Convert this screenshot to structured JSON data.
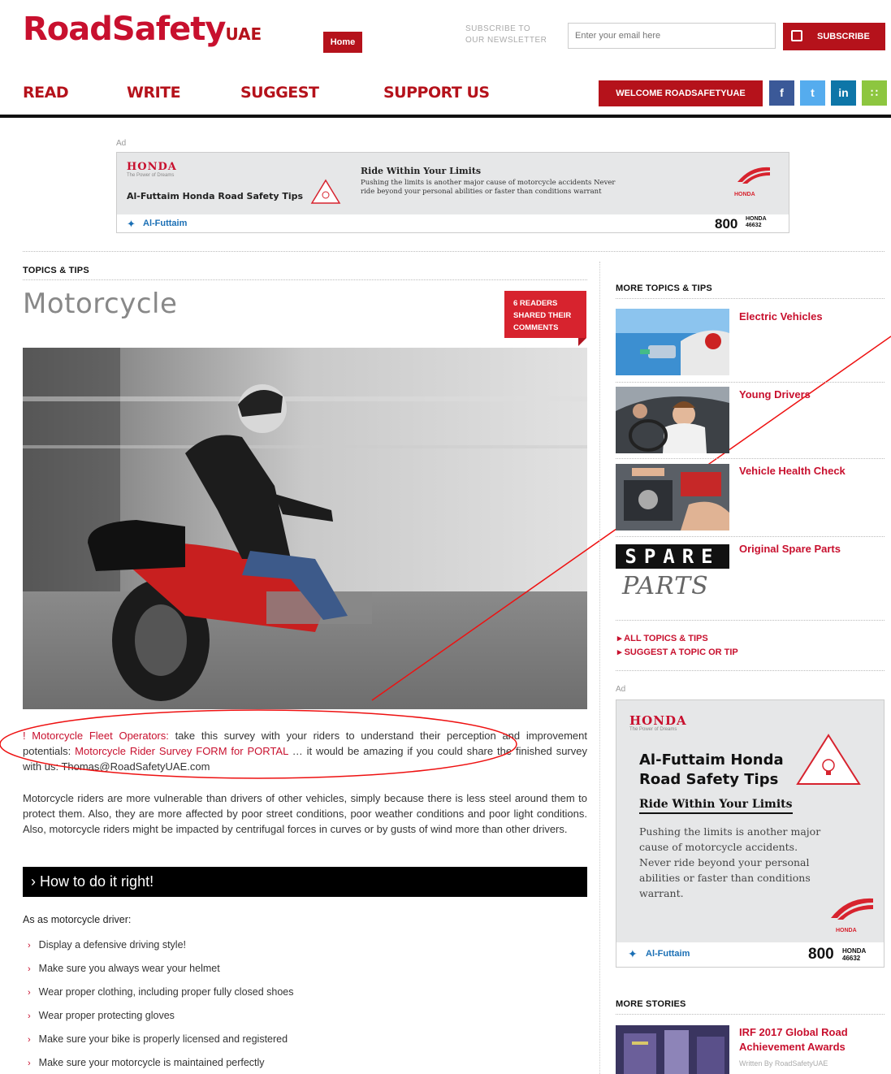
{
  "header": {
    "logo_road": "Road",
    "logo_safety": "Safety",
    "logo_uae": "UAE",
    "home_label": "Home",
    "subscribe_prompt_1": "SUBSCRIBE TO",
    "subscribe_prompt_2": "OUR NEWSLETTER",
    "email_placeholder": "Enter your email here",
    "subscribe_label": "SUBSCRIBE",
    "welcome_label": "WELCOME ROADSAFETYUAE",
    "colors": {
      "brand": "#b5121b",
      "accent": "#c8102e"
    }
  },
  "nav": {
    "items": [
      {
        "label": "READ"
      },
      {
        "label": "WRITE"
      },
      {
        "label": "SUGGEST"
      },
      {
        "label": "SUPPORT US"
      }
    ]
  },
  "social": [
    {
      "icon": "facebook-icon",
      "glyph": "f",
      "color": "#3b5998"
    },
    {
      "icon": "twitter-icon",
      "glyph": "t",
      "color": "#55acee"
    },
    {
      "icon": "linkedin-icon",
      "glyph": "in",
      "color": "#0e76a8"
    },
    {
      "icon": "rss-icon",
      "glyph": "∷",
      "color": "#8dc63f"
    }
  ],
  "top_ad": {
    "label": "Ad",
    "brand": "HONDA",
    "tagline": "The Power of Dreams",
    "title": "Al-Futtaim Honda Road Safety Tips",
    "headline": "Ride Within Your Limits",
    "body_1": "Pushing the limits is another major cause of motorcycle accidents Never",
    "body_2": "ride beyond your personal abilities or faster than conditions warrant",
    "partner": "Al-Futtaim",
    "phone": "800",
    "phone_word": "HONDA",
    "phone_digits": "46632",
    "logo_word": "HONDA"
  },
  "article": {
    "section": "TOPICS & TIPS",
    "title": "Motorcycle",
    "badge_1": "6 READERS",
    "badge_2": "SHARED THEIR",
    "badge_3": "COMMENTS",
    "survey_lead": "! Motorcycle Fleet Operators:",
    "survey_text_1": " take this survey with your riders to understand their perception and improvement potentials: ",
    "survey_link": "Motorcycle Rider Survey FORM for PORTAL",
    "survey_text_2": " … it would be amazing if you could share the finished survey with us: Thomas@RoadSafetyUAE.com",
    "intro": "Motorcycle riders are more vulnerable than drivers of other vehicles, simply because there is less steel around them to protect them. Also, they are more affected by poor street conditions, poor weather conditions and poor light conditions. Also, motorcycle riders might be impacted by centrifugal forces in curves or by gusts of wind more than other drivers.",
    "howto_title": "How to do it right!",
    "as_driver": "As as motorcycle driver:",
    "tips": [
      "Display a defensive driving style!",
      "Make sure you always wear your helmet",
      "Wear proper clothing, including proper fully closed shoes",
      "Wear proper protecting gloves",
      "Make sure your bike is properly licensed and registered",
      "Make sure your motorcycle is maintained perfectly"
    ]
  },
  "sidebar": {
    "more_topics": "MORE TOPICS & TIPS",
    "topics": [
      {
        "label": "Electric Vehicles"
      },
      {
        "label": "Young Drivers"
      },
      {
        "label": "Vehicle Health Check"
      },
      {
        "label": "Original Spare Parts"
      }
    ],
    "spare_1": "SPARE",
    "spare_2": "PARTS",
    "links": [
      {
        "label": "ALL TOPICS & TIPS"
      },
      {
        "label": "SUGGEST A TOPIC OR TIP"
      }
    ],
    "ad": {
      "label": "Ad",
      "brand": "HONDA",
      "tagline": "The Power of Dreams",
      "title_1": "Al-Futtaim Honda",
      "title_2": "Road Safety Tips",
      "headline": "Ride Within Your Limits",
      "body": "Pushing the limits is another major cause of motorcycle accidents. Never ride beyond your personal abilities or faster than conditions warrant.",
      "partner": "Al-Futtaim",
      "phone": "800",
      "phone_word": "HONDA",
      "phone_digits": "46632",
      "logo_word": "HONDA"
    },
    "more_stories": "MORE STORIES",
    "story_title_1": "IRF 2017 Global Road",
    "story_title_2": "Achievement Awards",
    "story_byline": "Written By RoadSafetyUAE"
  }
}
